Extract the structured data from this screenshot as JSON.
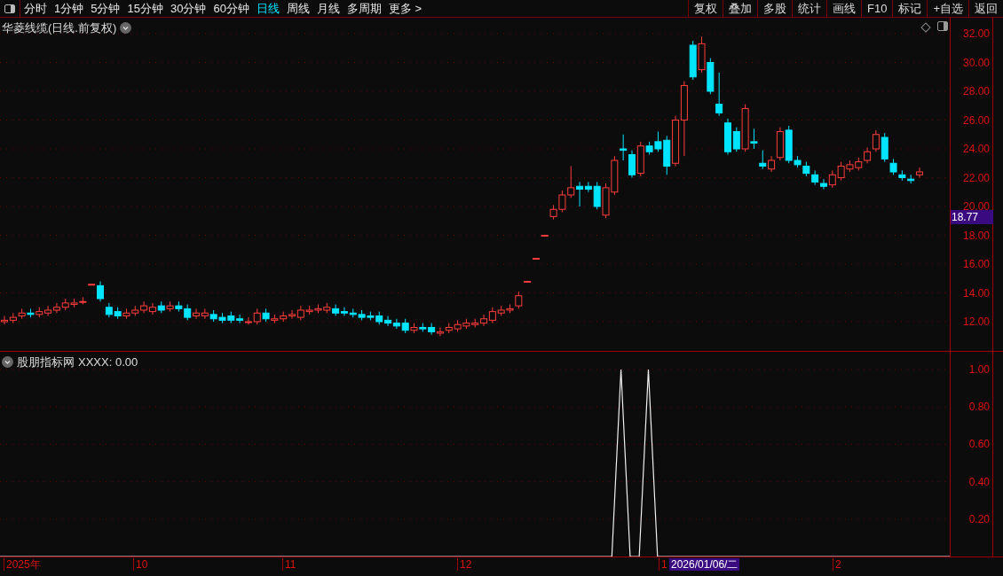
{
  "toolbar": {
    "periods": [
      {
        "label": "分时",
        "selected": false
      },
      {
        "label": "1分钟",
        "selected": false
      },
      {
        "label": "5分钟",
        "selected": false
      },
      {
        "label": "15分钟",
        "selected": false
      },
      {
        "label": "30分钟",
        "selected": false
      },
      {
        "label": "60分钟",
        "selected": false
      },
      {
        "label": "日线",
        "selected": true
      },
      {
        "label": "周线",
        "selected": false
      },
      {
        "label": "月线",
        "selected": false
      },
      {
        "label": "多周期",
        "selected": false
      },
      {
        "label": "更多 >",
        "selected": false
      }
    ],
    "actions": [
      "复权",
      "叠加",
      "多股",
      "统计",
      "画线",
      "F10",
      "标记",
      "+自选",
      "返回"
    ]
  },
  "main_chart": {
    "title": "华菱线缆(日线.前复权)",
    "current_price": "18.77",
    "chart_data": {
      "type": "candlestick",
      "grid": true,
      "ylim": [
        12,
        32
      ],
      "yticks": [
        {
          "value": 32,
          "label": "32.00"
        },
        {
          "value": 30,
          "label": "30.00"
        },
        {
          "value": 28,
          "label": "28.00"
        },
        {
          "value": 26,
          "label": "26.00"
        },
        {
          "value": 24,
          "label": "24.00"
        },
        {
          "value": 22,
          "label": "22.00"
        },
        {
          "value": 20,
          "label": "20.00"
        },
        {
          "value": 18,
          "label": "18.00"
        },
        {
          "value": 16,
          "label": "16.00"
        },
        {
          "value": 14,
          "label": "14.00"
        },
        {
          "value": 12,
          "label": "12.00"
        }
      ],
      "categories": [
        null,
        null,
        null,
        null,
        null,
        null,
        null,
        null,
        null,
        null,
        null,
        null,
        null,
        null,
        null,
        null,
        null,
        null,
        null,
        null,
        null,
        null,
        null,
        null,
        null,
        null,
        null,
        null,
        null,
        null,
        null,
        null,
        null,
        null,
        null,
        null,
        null,
        null,
        null,
        null,
        null,
        null,
        null,
        null,
        null,
        null,
        null,
        null,
        null,
        null,
        null,
        null,
        null,
        null,
        null,
        null,
        null,
        null,
        null,
        null,
        null,
        null,
        null,
        null,
        null,
        null,
        null,
        null,
        null,
        null,
        null,
        null,
        null,
        null,
        null,
        null,
        null,
        null,
        null,
        null,
        null,
        null,
        null,
        null,
        null,
        null,
        null,
        null,
        null,
        null,
        null,
        null,
        null,
        null,
        null,
        null,
        null,
        null,
        null,
        null,
        null,
        null,
        null,
        null,
        null,
        null
      ],
      "ohlc": [
        [
          12.0,
          12.4,
          11.8,
          12.1
        ],
        [
          12.1,
          12.6,
          11.9,
          12.3
        ],
        [
          12.4,
          12.9,
          12.2,
          12.6
        ],
        [
          12.6,
          12.9,
          12.3,
          12.5
        ],
        [
          12.5,
          13.0,
          12.3,
          12.7
        ],
        [
          12.6,
          13.1,
          12.4,
          12.8
        ],
        [
          12.8,
          13.3,
          12.6,
          13.0
        ],
        [
          13.0,
          13.6,
          12.8,
          13.3
        ],
        [
          13.2,
          13.6,
          13.0,
          13.3
        ],
        [
          13.4,
          13.7,
          13.2,
          13.4
        ],
        [
          14.6,
          14.6,
          14.6,
          14.6
        ],
        [
          14.5,
          14.8,
          13.4,
          13.6
        ],
        [
          13.0,
          13.3,
          12.3,
          12.5
        ],
        [
          12.7,
          13.0,
          12.2,
          12.4
        ],
        [
          12.4,
          12.9,
          12.2,
          12.6
        ],
        [
          12.6,
          13.1,
          12.4,
          12.8
        ],
        [
          12.8,
          13.4,
          12.6,
          13.1
        ],
        [
          12.7,
          13.3,
          12.5,
          13.0
        ],
        [
          13.1,
          13.4,
          12.6,
          12.8
        ],
        [
          12.9,
          13.4,
          12.7,
          13.1
        ],
        [
          13.1,
          13.4,
          12.7,
          12.9
        ],
        [
          12.9,
          13.2,
          12.1,
          12.3
        ],
        [
          12.4,
          12.9,
          12.2,
          12.6
        ],
        [
          12.4,
          12.9,
          12.2,
          12.6
        ],
        [
          12.5,
          12.8,
          12.0,
          12.2
        ],
        [
          12.3,
          12.6,
          11.9,
          12.1
        ],
        [
          12.4,
          12.7,
          11.9,
          12.1
        ],
        [
          12.2,
          12.5,
          11.9,
          12.1
        ],
        [
          12.0,
          12.3,
          11.8,
          12.0
        ],
        [
          12.0,
          12.9,
          11.8,
          12.6
        ],
        [
          12.6,
          12.9,
          12.0,
          12.2
        ],
        [
          12.1,
          12.5,
          11.9,
          12.2
        ],
        [
          12.2,
          12.7,
          12.0,
          12.4
        ],
        [
          12.4,
          12.8,
          12.2,
          12.5
        ],
        [
          12.3,
          13.1,
          12.1,
          12.8
        ],
        [
          12.7,
          13.1,
          12.5,
          12.8
        ],
        [
          12.8,
          13.2,
          12.6,
          12.9
        ],
        [
          12.8,
          13.3,
          12.6,
          13.0
        ],
        [
          12.9,
          13.2,
          12.4,
          12.6
        ],
        [
          12.7,
          13.0,
          12.4,
          12.6
        ],
        [
          12.6,
          12.9,
          12.3,
          12.5
        ],
        [
          12.5,
          12.8,
          12.1,
          12.3
        ],
        [
          12.4,
          12.7,
          12.1,
          12.3
        ],
        [
          12.4,
          12.7,
          11.8,
          12.0
        ],
        [
          12.1,
          12.4,
          11.7,
          11.9
        ],
        [
          11.9,
          12.2,
          11.5,
          11.7
        ],
        [
          11.9,
          12.2,
          11.2,
          11.4
        ],
        [
          11.4,
          11.9,
          11.2,
          11.6
        ],
        [
          11.6,
          11.9,
          11.3,
          11.5
        ],
        [
          11.6,
          11.9,
          11.1,
          11.3
        ],
        [
          11.2,
          11.6,
          11.0,
          11.3
        ],
        [
          11.4,
          11.9,
          11.2,
          11.6
        ],
        [
          11.5,
          12.1,
          11.3,
          11.8
        ],
        [
          11.7,
          12.2,
          11.5,
          11.9
        ],
        [
          11.8,
          12.2,
          11.6,
          11.9
        ],
        [
          11.9,
          12.5,
          11.7,
          12.2
        ],
        [
          12.1,
          13.0,
          11.9,
          12.7
        ],
        [
          12.6,
          13.1,
          12.4,
          12.8
        ],
        [
          12.8,
          13.2,
          12.6,
          12.9
        ],
        [
          13.1,
          14.1,
          12.9,
          13.8
        ],
        [
          14.8,
          14.8,
          14.8,
          14.8
        ],
        [
          16.4,
          16.4,
          16.4,
          16.4
        ],
        [
          18.0,
          18.0,
          18.0,
          18.0
        ],
        [
          19.3,
          20.1,
          19.1,
          19.8
        ],
        [
          19.8,
          21.1,
          19.6,
          20.8
        ],
        [
          20.8,
          22.8,
          20.6,
          21.3
        ],
        [
          21.4,
          21.7,
          20.0,
          21.2
        ],
        [
          21.4,
          21.7,
          21.0,
          21.2
        ],
        [
          21.4,
          21.7,
          19.8,
          20.0
        ],
        [
          19.4,
          21.6,
          19.2,
          21.3
        ],
        [
          21.0,
          23.5,
          20.8,
          23.2
        ],
        [
          24.0,
          25.0,
          23.2,
          23.9
        ],
        [
          23.6,
          23.9,
          22.0,
          22.2
        ],
        [
          22.3,
          24.5,
          22.1,
          24.2
        ],
        [
          24.2,
          24.5,
          23.6,
          23.8
        ],
        [
          24.5,
          25.2,
          23.8,
          24.0
        ],
        [
          24.6,
          24.9,
          22.2,
          22.8
        ],
        [
          23.0,
          26.3,
          22.8,
          26.0
        ],
        [
          26.0,
          28.7,
          23.5,
          28.4
        ],
        [
          31.2,
          31.5,
          28.8,
          29.0
        ],
        [
          29.5,
          31.8,
          29.3,
          31.3
        ],
        [
          30.0,
          30.3,
          27.8,
          28.0
        ],
        [
          27.1,
          29.3,
          26.3,
          26.5
        ],
        [
          25.8,
          26.1,
          23.6,
          23.8
        ],
        [
          25.2,
          25.5,
          23.8,
          24.0
        ],
        [
          24.0,
          27.1,
          23.8,
          26.8
        ],
        [
          24.5,
          25.4,
          24.0,
          24.4
        ],
        [
          23.0,
          23.9,
          22.6,
          22.8
        ],
        [
          22.6,
          23.5,
          22.4,
          23.2
        ],
        [
          23.4,
          25.5,
          23.2,
          25.2
        ],
        [
          25.3,
          25.6,
          23.0,
          23.2
        ],
        [
          23.2,
          23.5,
          22.7,
          22.9
        ],
        [
          22.8,
          23.1,
          22.1,
          22.3
        ],
        [
          22.2,
          22.5,
          21.5,
          21.7
        ],
        [
          21.6,
          21.9,
          21.2,
          21.4
        ],
        [
          21.5,
          22.5,
          21.3,
          22.2
        ],
        [
          22.0,
          23.1,
          21.8,
          22.8
        ],
        [
          22.6,
          23.2,
          22.4,
          22.9
        ],
        [
          22.7,
          23.4,
          22.5,
          23.1
        ],
        [
          23.2,
          24.1,
          23.0,
          23.8
        ],
        [
          24.0,
          25.3,
          23.8,
          25.0
        ],
        [
          24.8,
          25.1,
          23.1,
          23.3
        ],
        [
          23.0,
          23.3,
          22.2,
          22.4
        ],
        [
          22.2,
          22.5,
          21.8,
          22.0
        ],
        [
          21.9,
          22.2,
          21.6,
          21.8
        ],
        [
          22.2,
          22.7,
          22.0,
          22.4
        ]
      ]
    }
  },
  "indicator": {
    "title": "股朋指标网",
    "value": ": 0.00",
    "chart_data": {
      "type": "line",
      "grid": true,
      "ylim": [
        0,
        1
      ],
      "yticks": [
        {
          "value": 1,
          "label": "1.00"
        },
        {
          "value": 0.8,
          "label": "0.80"
        },
        {
          "value": 0.6,
          "label": "0.60"
        },
        {
          "value": 0.4,
          "label": "0.40"
        },
        {
          "value": 0.2,
          "label": "0.20"
        }
      ],
      "categories": [
        null,
        null,
        null,
        null,
        null,
        null,
        null,
        null,
        null,
        null,
        null,
        null,
        null,
        null,
        null,
        null,
        null,
        null,
        null,
        null,
        null,
        null,
        null,
        null,
        null,
        null,
        null,
        null,
        null,
        null,
        null,
        null,
        null,
        null,
        null,
        null,
        null,
        null,
        null,
        null,
        null,
        null,
        null,
        null,
        null,
        null,
        null,
        null,
        null,
        null,
        null,
        null,
        null,
        null,
        null,
        null,
        null,
        null,
        null,
        null,
        null,
        null,
        null,
        null,
        null,
        null,
        null,
        null,
        null,
        null,
        null,
        null,
        null,
        null,
        null,
        null,
        null,
        null,
        null,
        null,
        null,
        null,
        null,
        null,
        null,
        null,
        null,
        null,
        null,
        null,
        null,
        null,
        null,
        null,
        null,
        null,
        null,
        null,
        null,
        null,
        null,
        null,
        null,
        null,
        null
      ],
      "series": [
        {
          "name": "XXXX",
          "color": "#f0f0f0",
          "values": [
            0,
            0,
            0,
            0,
            0,
            0,
            0,
            0,
            0,
            0,
            0,
            0,
            0,
            0,
            0,
            0,
            0,
            0,
            0,
            0,
            0,
            0,
            0,
            0,
            0,
            0,
            0,
            0,
            0,
            0,
            0,
            0,
            0,
            0,
            0,
            0,
            0,
            0,
            0,
            0,
            0,
            0,
            0,
            0,
            0,
            0,
            0,
            0,
            0,
            0,
            0,
            0,
            0,
            0,
            0,
            0,
            0,
            0,
            0,
            0,
            0,
            0,
            0,
            0,
            0,
            0,
            0,
            0,
            1,
            0,
            0,
            1,
            0,
            0,
            0,
            0,
            0,
            0,
            0,
            0,
            0,
            0,
            0,
            0,
            0,
            0,
            0,
            0,
            0,
            0,
            0,
            0,
            0,
            0,
            0,
            0,
            0,
            0,
            0,
            0,
            0,
            0,
            0,
            0,
            0
          ]
        }
      ]
    }
  },
  "time_axis": {
    "labels": [
      "2025年",
      "10",
      "11",
      "12",
      "1",
      "2"
    ],
    "cursor_date": "2026/01/06/二"
  }
}
